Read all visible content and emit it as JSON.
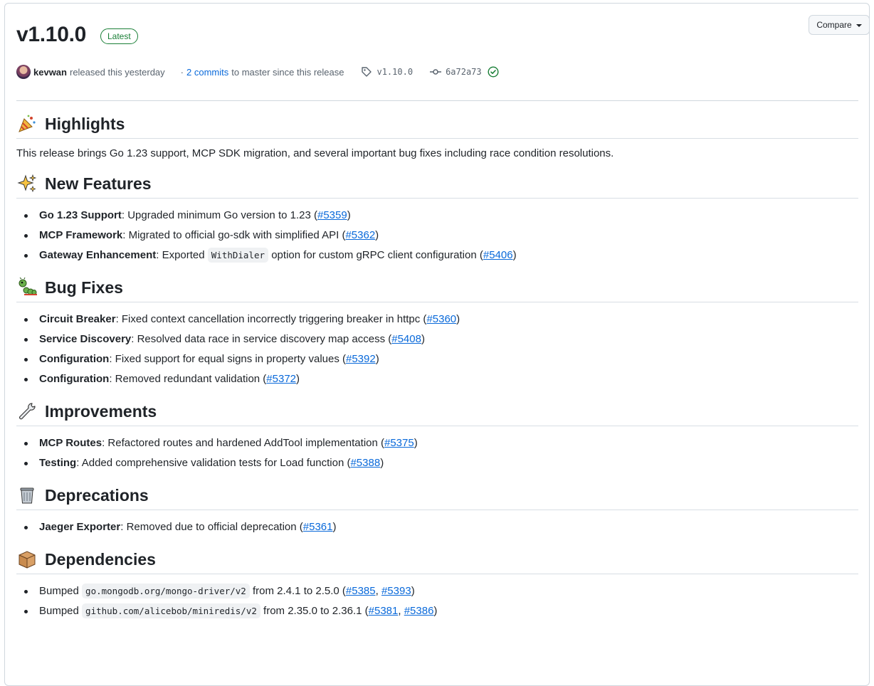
{
  "release": {
    "title": "v1.10.0",
    "badge": "Latest",
    "compare_label": "Compare",
    "author": "kevwan",
    "released_text": "released this yesterday",
    "commits_link": "2 commits",
    "commits_suffix": "to master since this release",
    "tag": "v1.10.0",
    "commit": "6a72a73"
  },
  "sections": {
    "highlights": {
      "title": "Highlights",
      "text": "This release brings Go 1.23 support, MCP SDK migration, and several important bug fixes including race condition resolutions."
    },
    "features": {
      "title": "New Features",
      "items": [
        {
          "bold": "Go 1.23 Support",
          "text": ": Upgraded minimum Go version to 1.23 (",
          "pr": "#5359",
          "end": ")"
        },
        {
          "bold": "MCP Framework",
          "text": ": Migrated to official go-sdk with simplified API (",
          "pr": "#5362",
          "end": ")"
        },
        {
          "bold": "Gateway Enhancement",
          "text": ": Exported ",
          "code": "WithDialer",
          "text2": " option for custom gRPC client configuration (",
          "pr": "#5406",
          "end": ")"
        }
      ]
    },
    "bugs": {
      "title": "Bug Fixes",
      "items": [
        {
          "bold": "Circuit Breaker",
          "text": ": Fixed context cancellation incorrectly triggering breaker in httpc (",
          "pr": "#5360",
          "end": ")"
        },
        {
          "bold": "Service Discovery",
          "text": ": Resolved data race in service discovery map access (",
          "pr": "#5408",
          "end": ")"
        },
        {
          "bold": "Configuration",
          "text": ": Fixed support for equal signs in property values (",
          "pr": "#5392",
          "end": ")"
        },
        {
          "bold": "Configuration",
          "text": ": Removed redundant validation (",
          "pr": "#5372",
          "end": ")"
        }
      ]
    },
    "improvements": {
      "title": "Improvements",
      "items": [
        {
          "bold": "MCP Routes",
          "text": ": Refactored routes and hardened AddTool implementation (",
          "pr": "#5375",
          "end": ")"
        },
        {
          "bold": "Testing",
          "text": ": Added comprehensive validation tests for Load function (",
          "pr": "#5388",
          "end": ")"
        }
      ]
    },
    "deprecations": {
      "title": "Deprecations",
      "items": [
        {
          "bold": "Jaeger Exporter",
          "text": ": Removed due to official deprecation (",
          "pr": "#5361",
          "end": ")"
        }
      ]
    },
    "dependencies": {
      "title": "Dependencies",
      "items": [
        {
          "prefix": "Bumped ",
          "code": "go.mongodb.org/mongo-driver/v2",
          "text": " from 2.4.1 to 2.5.0 (",
          "pr": "#5385",
          "sep": ", ",
          "pr2": "#5393",
          "end": ")"
        },
        {
          "prefix": "Bumped ",
          "code": "github.com/alicebob/miniredis/v2",
          "text": " from 2.35.0 to 2.36.1 (",
          "pr": "#5381",
          "sep": ", ",
          "pr2": "#5386",
          "end": ")"
        }
      ]
    }
  },
  "icons": {
    "highlights": "party-popper-icon",
    "features": "sparkles-icon",
    "bugs": "bug-icon",
    "improvements": "wrench-icon",
    "deprecations": "wastebasket-icon",
    "dependencies": "package-icon"
  },
  "colors": {
    "link": "#0969da",
    "badge": "#1a7f37",
    "border": "#d0d7de"
  }
}
